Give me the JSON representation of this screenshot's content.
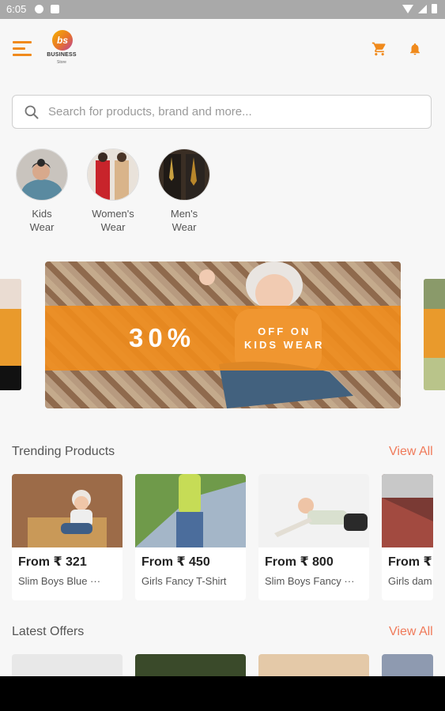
{
  "status_bar": {
    "time": "6:05"
  },
  "search": {
    "placeholder": "Search for products, brand and more..."
  },
  "categories": [
    {
      "label": "Kids\nWear"
    },
    {
      "label": "Women's\nWear"
    },
    {
      "label": "Men's\nWear"
    }
  ],
  "banner": {
    "percent": "30%",
    "off_line1": "OFF ON",
    "off_line2": "KIDS WEAR"
  },
  "trending": {
    "title": "Trending Products",
    "view_all": "View All",
    "products": [
      {
        "price": "From  ₹ 321",
        "name": "Slim Boys Blue ···"
      },
      {
        "price": "From  ₹ 450",
        "name": "Girls Fancy T-Shirt"
      },
      {
        "price": "From  ₹ 800",
        "name": "Slim Boys Fancy ···"
      },
      {
        "price": "From  ₹",
        "name": "Girls dam"
      }
    ]
  },
  "latest": {
    "title": "Latest Offers",
    "view_all": "View All"
  },
  "logo": {
    "text": "BUSINESS",
    "sub": "Store",
    "mark": "bs"
  },
  "colors": {
    "accent": "#f08a1c",
    "link": "#f07a5a"
  }
}
